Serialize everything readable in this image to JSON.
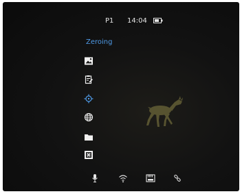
{
  "status_bar": {
    "profile": "P1",
    "time": "14:04",
    "battery_icon": "battery-icon"
  },
  "menu": {
    "title": "Zeroing",
    "accent_color": "#4f9be8",
    "items": [
      {
        "icon": "image-icon",
        "active": false
      },
      {
        "icon": "clipboard-icon",
        "active": false
      },
      {
        "icon": "crosshair-icon",
        "active": true
      },
      {
        "icon": "globe-icon",
        "active": false
      },
      {
        "icon": "folder-icon",
        "active": false
      },
      {
        "icon": "dead-pixel-icon",
        "active": false
      }
    ]
  },
  "bottom_bar": {
    "icons": [
      "microphone-icon",
      "wifi-icon",
      "memory-card-icon",
      "link-icon"
    ]
  }
}
